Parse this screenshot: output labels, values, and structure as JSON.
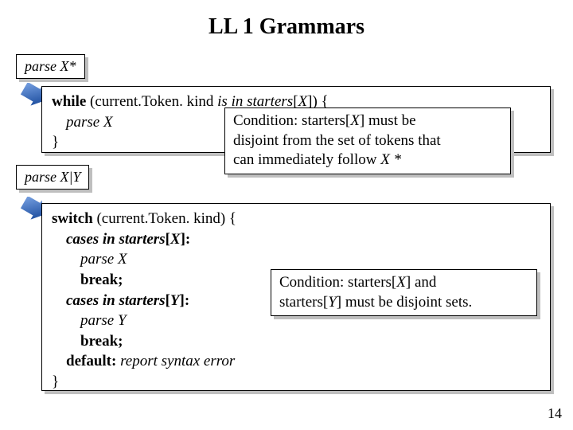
{
  "title": "LL 1 Grammars",
  "pagenum": "14",
  "label_star": "parse X*",
  "label_alt": "parse X|Y",
  "block1": {
    "while": "while",
    "cond_l": " (current.Token. kind ",
    "cond_mid": "is in starters",
    "cond_r": "[",
    "x": "X",
    "cond_end": "]) {",
    "body": "parse X",
    "close": "}"
  },
  "note1": {
    "line1a": "Condition: ",
    "line1b": "starters",
    "line1c": "[",
    "line1x": "X",
    "line1d": "] ",
    "line1e": "must be",
    "line2": "disjoint from the set of tokens that",
    "line3": "can immediately follow ",
    "line3x": "X *"
  },
  "block2": {
    "switch": "switch",
    "switch_r": " (current.Token. kind) {",
    "cases1a": "cases in starters",
    "cases1b": "[",
    "cases1x": "X",
    "cases1c": "]:",
    "px": "parse X",
    "break": "break;",
    "cases2a": "cases in starters",
    "cases2b": "[",
    "cases2y": "Y",
    "cases2c": "]:",
    "py": "parse Y",
    "default": "default: ",
    "report": "report syntax error",
    "close": "}"
  },
  "note2": {
    "line1a": "Condition: ",
    "line1b": "starters",
    "line1c": "[",
    "line1x": "X",
    "line1d": "] ",
    "line1e": "and",
    "line2a": "starters",
    "line2b": "[",
    "line2y": "Y",
    "line2c": "] ",
    "line2d": "must be disjoint sets."
  }
}
